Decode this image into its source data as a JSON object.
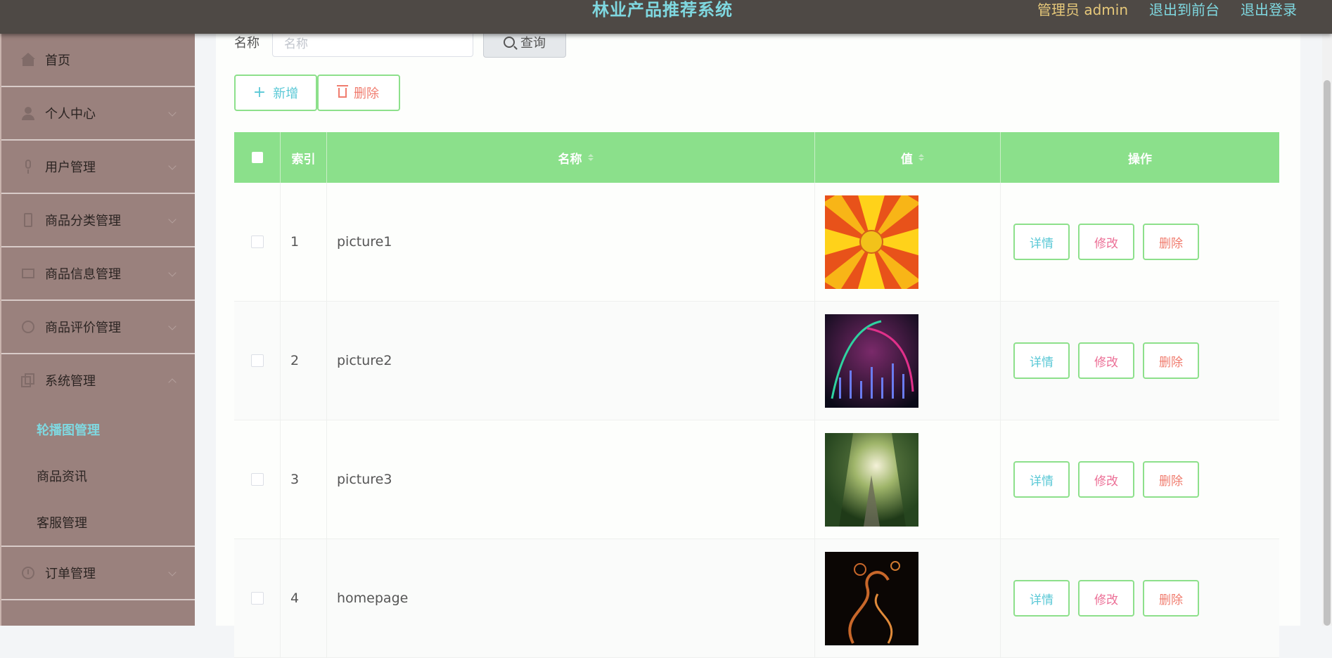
{
  "header": {
    "title": "林业产品推荐系统",
    "admin_label": "管理员 admin",
    "to_front": "退出到前台",
    "logout": "退出登录"
  },
  "sidebar": {
    "items": [
      {
        "label": "首页",
        "icon": "home-icon"
      },
      {
        "label": "个人中心",
        "icon": "user-icon"
      },
      {
        "label": "用户管理",
        "icon": "mic-icon"
      },
      {
        "label": "商品分类管理",
        "icon": "phone-icon"
      },
      {
        "label": "商品信息管理",
        "icon": "box-icon"
      },
      {
        "label": "商品评价管理",
        "icon": "circle-icon"
      },
      {
        "label": "系统管理",
        "icon": "copy-icon"
      },
      {
        "label": "订单管理",
        "icon": "clock-icon"
      }
    ],
    "submenu": [
      {
        "label": "轮播图管理",
        "active": true
      },
      {
        "label": "商品资讯",
        "active": false
      },
      {
        "label": "客服管理",
        "active": false
      }
    ]
  },
  "search": {
    "label": "名称",
    "placeholder": "名称",
    "button": "查询"
  },
  "actions": {
    "add": "新增",
    "delete": "删除"
  },
  "table": {
    "headers": {
      "index": "索引",
      "name": "名称",
      "value": "值",
      "ops": "操作"
    },
    "rows": [
      {
        "index": "1",
        "name": "picture1"
      },
      {
        "index": "2",
        "name": "picture2"
      },
      {
        "index": "3",
        "name": "picture3"
      },
      {
        "index": "4",
        "name": "homepage"
      }
    ],
    "row_buttons": {
      "detail": "详情",
      "edit": "修改",
      "delete": "删除"
    }
  },
  "colors": {
    "header_bg": "#4e4945",
    "sidebar_bg": "#9a817d",
    "table_header": "#8be08b",
    "accent": "#7fd8e0"
  }
}
